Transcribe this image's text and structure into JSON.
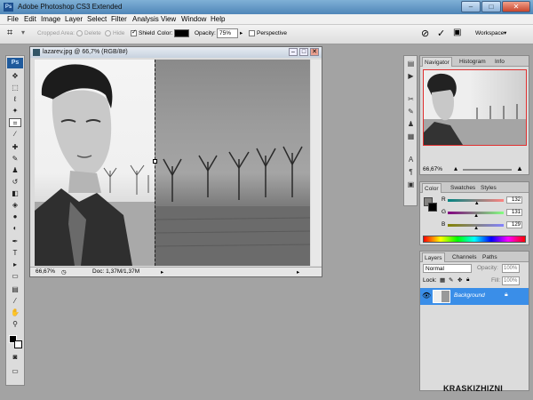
{
  "app": {
    "title": "Adobe Photoshop CS3 Extended"
  },
  "menu": [
    "File",
    "Edit",
    "Image",
    "Layer",
    "Select",
    "Filter",
    "Analysis",
    "View",
    "Window",
    "Help"
  ],
  "options": {
    "cropped_area_label": "Cropped Area:",
    "delete_label": "Delete",
    "hide_label": "Hide",
    "shield_label": "Shield",
    "shield_checked": true,
    "color_label": "Color:",
    "opacity_label": "Opacity:",
    "opacity_value": "75%",
    "perspective_label": "Perspective",
    "perspective_checked": false,
    "workspace_label": "Workspace"
  },
  "document": {
    "title": "lazarev.jpg @ 66,7% (RGB/8#)",
    "zoom": "66,67%",
    "doc_info": "Doc: 1,37M/1,37M"
  },
  "navigator": {
    "tabs": [
      "Navigator",
      "Histogram",
      "Info"
    ],
    "zoom": "66,67%"
  },
  "color_panel": {
    "tabs": [
      "Color",
      "Swatches",
      "Styles"
    ],
    "channels": [
      {
        "name": "R",
        "value": "132",
        "fraction": 0.52
      },
      {
        "name": "G",
        "value": "131",
        "fraction": 0.51
      },
      {
        "name": "B",
        "value": "129",
        "fraction": 0.51
      }
    ]
  },
  "layers_panel": {
    "tabs": [
      "Layers",
      "Channels",
      "Paths"
    ],
    "blend_mode": "Normal",
    "opacity_label": "Opacity:",
    "opacity_value": "100%",
    "lock_label": "Lock:",
    "fill_label": "Fill:",
    "fill_value": "100%",
    "layers": [
      {
        "name": "Background",
        "selected": true
      }
    ]
  },
  "watermark": "KRASKIZHIZNI",
  "colors": {
    "selected_layer": "#3a8ee8",
    "nav_frame": "#e03030"
  }
}
